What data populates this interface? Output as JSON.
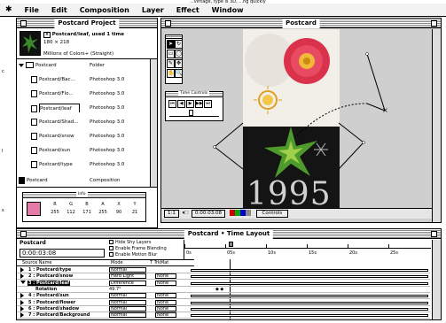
{
  "top_caption": "...vintage, type is 3D, ...ng quickly",
  "menu": {
    "items": [
      "File",
      "Edit",
      "Composition",
      "Layer",
      "Effect",
      "Window"
    ]
  },
  "project": {
    "title": "Postcard Project",
    "item_name": "Postcard/leaf, used 1 time",
    "dims": "180 × 218",
    "colors": "Millions of Colors+ (Straight)",
    "rows": [
      {
        "name": "Postcard",
        "type": "Folder",
        "kind": "folder"
      },
      {
        "name": "Postcard/Bac...",
        "type": "Photoshop 3.0",
        "kind": "file"
      },
      {
        "name": "Postcard/Flo...",
        "type": "Photoshop 3.0",
        "kind": "file"
      },
      {
        "name": "Postcard/leaf",
        "type": "Photoshop 3.0",
        "kind": "file"
      },
      {
        "name": "Postcard/Shad...",
        "type": "Photoshop 3.0",
        "kind": "file"
      },
      {
        "name": "Postcard/snow",
        "type": "Photoshop 3.0",
        "kind": "file"
      },
      {
        "name": "Postcard/sun",
        "type": "Photoshop 3.0",
        "kind": "file"
      },
      {
        "name": "Postcard/type",
        "type": "Photoshop 3.0",
        "kind": "file"
      },
      {
        "name": "Postcard",
        "type": "Composition",
        "kind": "comp"
      }
    ]
  },
  "info": {
    "title": "Info",
    "headers": [
      "R",
      "G",
      "B",
      "A",
      "X",
      "Y"
    ],
    "values": [
      "255",
      "112",
      "171",
      "255",
      "90",
      "21"
    ],
    "swatch_color": "#e67aa8"
  },
  "comp": {
    "title": "Postcard",
    "year_text": "1995",
    "zoom": "1:1",
    "timecode": "0:00:03:08",
    "controls_menu": "Controls"
  },
  "time_controls": {
    "title": "Time Controls"
  },
  "timeline": {
    "title": "Postcard • Time Layout",
    "comp_tab": "Postcard",
    "timecode": "0:00:03:08",
    "options": [
      "Hide Shy Layers",
      "Enable Frame Blending",
      "Enable Motion Blur"
    ],
    "col_source": "Source Name",
    "col_mode": "Mode",
    "col_trkmat": "T TrkMat",
    "ruler_labels": [
      "0s",
      "05s",
      "10s",
      "15s",
      "20s",
      "25s"
    ],
    "layers": [
      {
        "label": "1 : Postcard/type",
        "mode": "Normal",
        "trk": ""
      },
      {
        "label": "2 : Postcard/snow",
        "mode": "Hard Light",
        "trk": "None"
      },
      {
        "label": "3 : Postcard/leaf",
        "mode": "Difference",
        "trk": "None"
      },
      {
        "label": "Rotation",
        "mode": "49.7°",
        "trk": ""
      },
      {
        "label": "4 : Postcard/sun",
        "mode": "Normal",
        "trk": "None"
      },
      {
        "label": "5 : Postcard/flower",
        "mode": "Normal",
        "trk": "None"
      },
      {
        "label": "6 : Postcard/shadow",
        "mode": "Normal",
        "trk": "None"
      },
      {
        "label": "7 : Postcard/Background",
        "mode": "Normal",
        "trk": "None"
      }
    ]
  }
}
